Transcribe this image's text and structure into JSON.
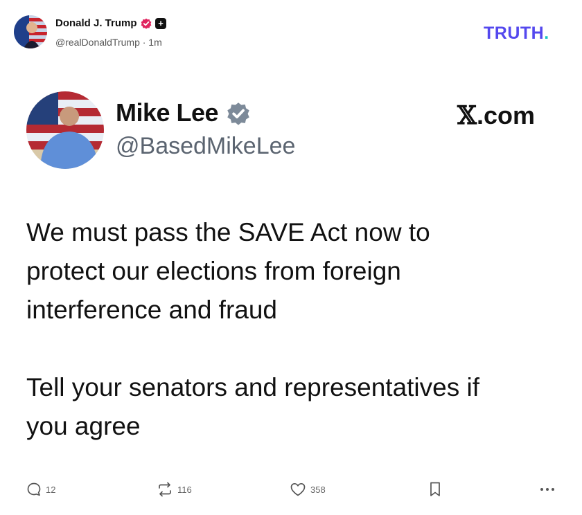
{
  "post": {
    "author_name": "Donald J. Trump",
    "handle_time": "@realDonaldTrump · 1m",
    "brand": "TRUTH",
    "brand_dot": ".",
    "icons": {
      "verified": "verified-badge-icon",
      "plus": "plus-badge-icon"
    }
  },
  "embed": {
    "name": "Mike Lee",
    "handle": "@BasedMikeLee",
    "domain_mark": "𝕏",
    "domain_text": ".com",
    "body": "We must pass the SAVE Act now to\nprotect our elections from foreign\ninterference and fraud\n\nTell your senators and representatives if\nyou agree"
  },
  "actions": {
    "replies": "12",
    "reposts": "116",
    "likes": "358",
    "icons": [
      "reply-icon",
      "repost-icon",
      "like-icon",
      "bookmark-icon",
      "more-icon"
    ]
  },
  "colors": {
    "brand": "#5448ee",
    "brand_dot": "#18c6c2",
    "verified_pink": "#e0245e",
    "verified_gray": "#7d8a99"
  }
}
